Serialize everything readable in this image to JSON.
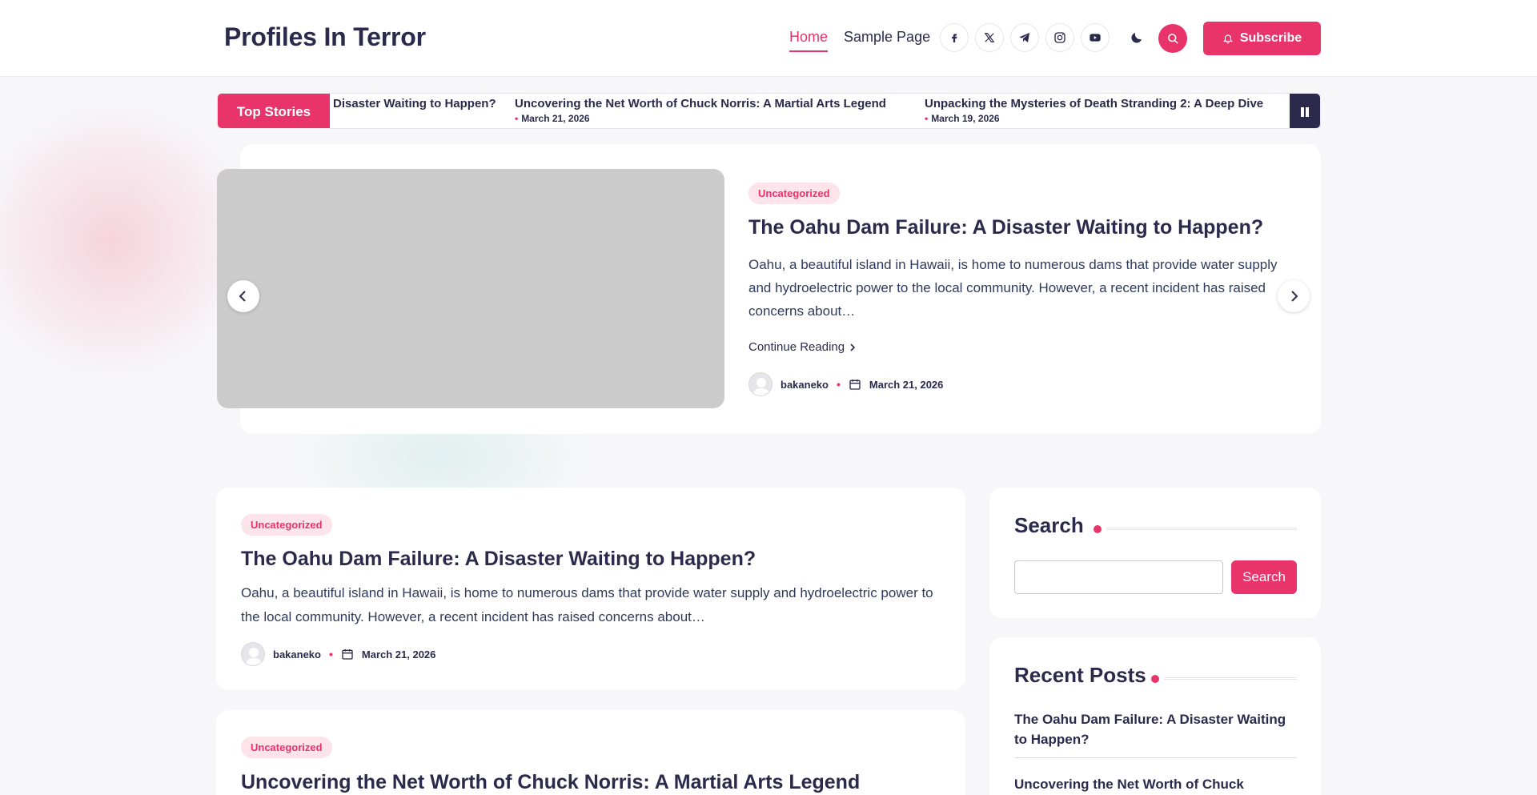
{
  "site": {
    "title": "Profiles In Terror"
  },
  "nav": {
    "items": [
      {
        "label": "Home"
      },
      {
        "label": "Sample Page"
      }
    ]
  },
  "social": {
    "icons": [
      "facebook-icon",
      "x-twitter-icon",
      "telegram-icon",
      "instagram-icon",
      "youtube-icon"
    ]
  },
  "header": {
    "subscribe_label": "Subscribe"
  },
  "ticker": {
    "label": "Top Stories",
    "items": [
      {
        "title": "Disaster Waiting to Happen?",
        "date": ""
      },
      {
        "title": "Uncovering the Net Worth of Chuck Norris: A Martial Arts Legend",
        "date": "March 21, 2026"
      },
      {
        "title": "Unpacking the Mysteries of Death Stranding 2: A Deep Dive",
        "date": "March 19, 2026"
      }
    ]
  },
  "featured": {
    "category": "Uncategorized",
    "title": "The Oahu Dam Failure: A Disaster Waiting to Happen?",
    "excerpt": "Oahu, a beautiful island in Hawaii, is home to numerous dams that provide water supply and hydroelectric power to the local community. However, a recent incident has raised concerns about…",
    "continue_label": "Continue Reading",
    "author": "bakaneko",
    "date": "March 21, 2026"
  },
  "posts": [
    {
      "category": "Uncategorized",
      "title": "The Oahu Dam Failure: A Disaster Waiting to Happen?",
      "excerpt": "Oahu, a beautiful island in Hawaii, is home to numerous dams that provide water supply and hydroelectric power to the local community. However, a recent incident has raised concerns about…",
      "author": "bakaneko",
      "date": "March 21, 2026"
    },
    {
      "category": "Uncategorized",
      "title": "Uncovering the Net Worth of Chuck Norris: A Martial Arts Legend"
    }
  ],
  "sidebar": {
    "search": {
      "title": "Search",
      "button_label": "Search",
      "placeholder": ""
    },
    "recent": {
      "title": "Recent Posts",
      "items": [
        {
          "title": "The Oahu Dam Failure: A Disaster Waiting to Happen?"
        },
        {
          "title": "Uncovering the Net Worth of Chuck"
        }
      ]
    }
  },
  "colors": {
    "accent": "#e8336b",
    "text": "#2b2a4c",
    "background": "#f7f7f9"
  }
}
